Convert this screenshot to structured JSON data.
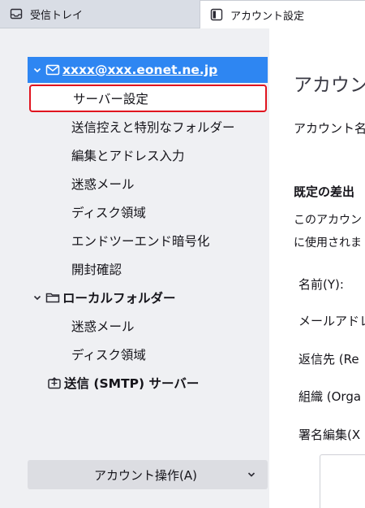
{
  "tabs": [
    {
      "label": "受信トレイ",
      "icon": "inbox-icon"
    },
    {
      "label": "アカウント設定",
      "icon": "settings-page-icon"
    }
  ],
  "sidebar": {
    "account": {
      "label": "xxxx@xxx.eonet.ne.jp"
    },
    "account_children": [
      {
        "label": "サーバー設定"
      },
      {
        "label": "送信控えと特別なフォルダー"
      },
      {
        "label": "編集とアドレス入力"
      },
      {
        "label": "迷惑メール"
      },
      {
        "label": "ディスク領域"
      },
      {
        "label": "エンドツーエンド暗号化"
      },
      {
        "label": "開封確認"
      }
    ],
    "local_folders": {
      "label": "ローカルフォルダー"
    },
    "local_children": [
      {
        "label": "迷惑メール"
      },
      {
        "label": "ディスク領域"
      }
    ],
    "smtp": {
      "label": "送信 (SMTP) サーバー"
    },
    "account_actions_label": "アカウント操作(A)"
  },
  "main": {
    "title": "アカウント",
    "account_name_label": "アカウント名(",
    "section_default": "既定の差出",
    "desc_line1": "このアカウント",
    "desc_line2": "に使用されま",
    "name_label": "名前(Y):",
    "email_label": "メールアドレス",
    "reply_to_label": "返信先 (Re",
    "org_label": "組織 (Orga",
    "signature_label": "署名編集(X"
  },
  "colors": {
    "selected": "#2e86f2",
    "highlight_border": "#e0141f",
    "sidebar_bg": "#eff0f3"
  }
}
